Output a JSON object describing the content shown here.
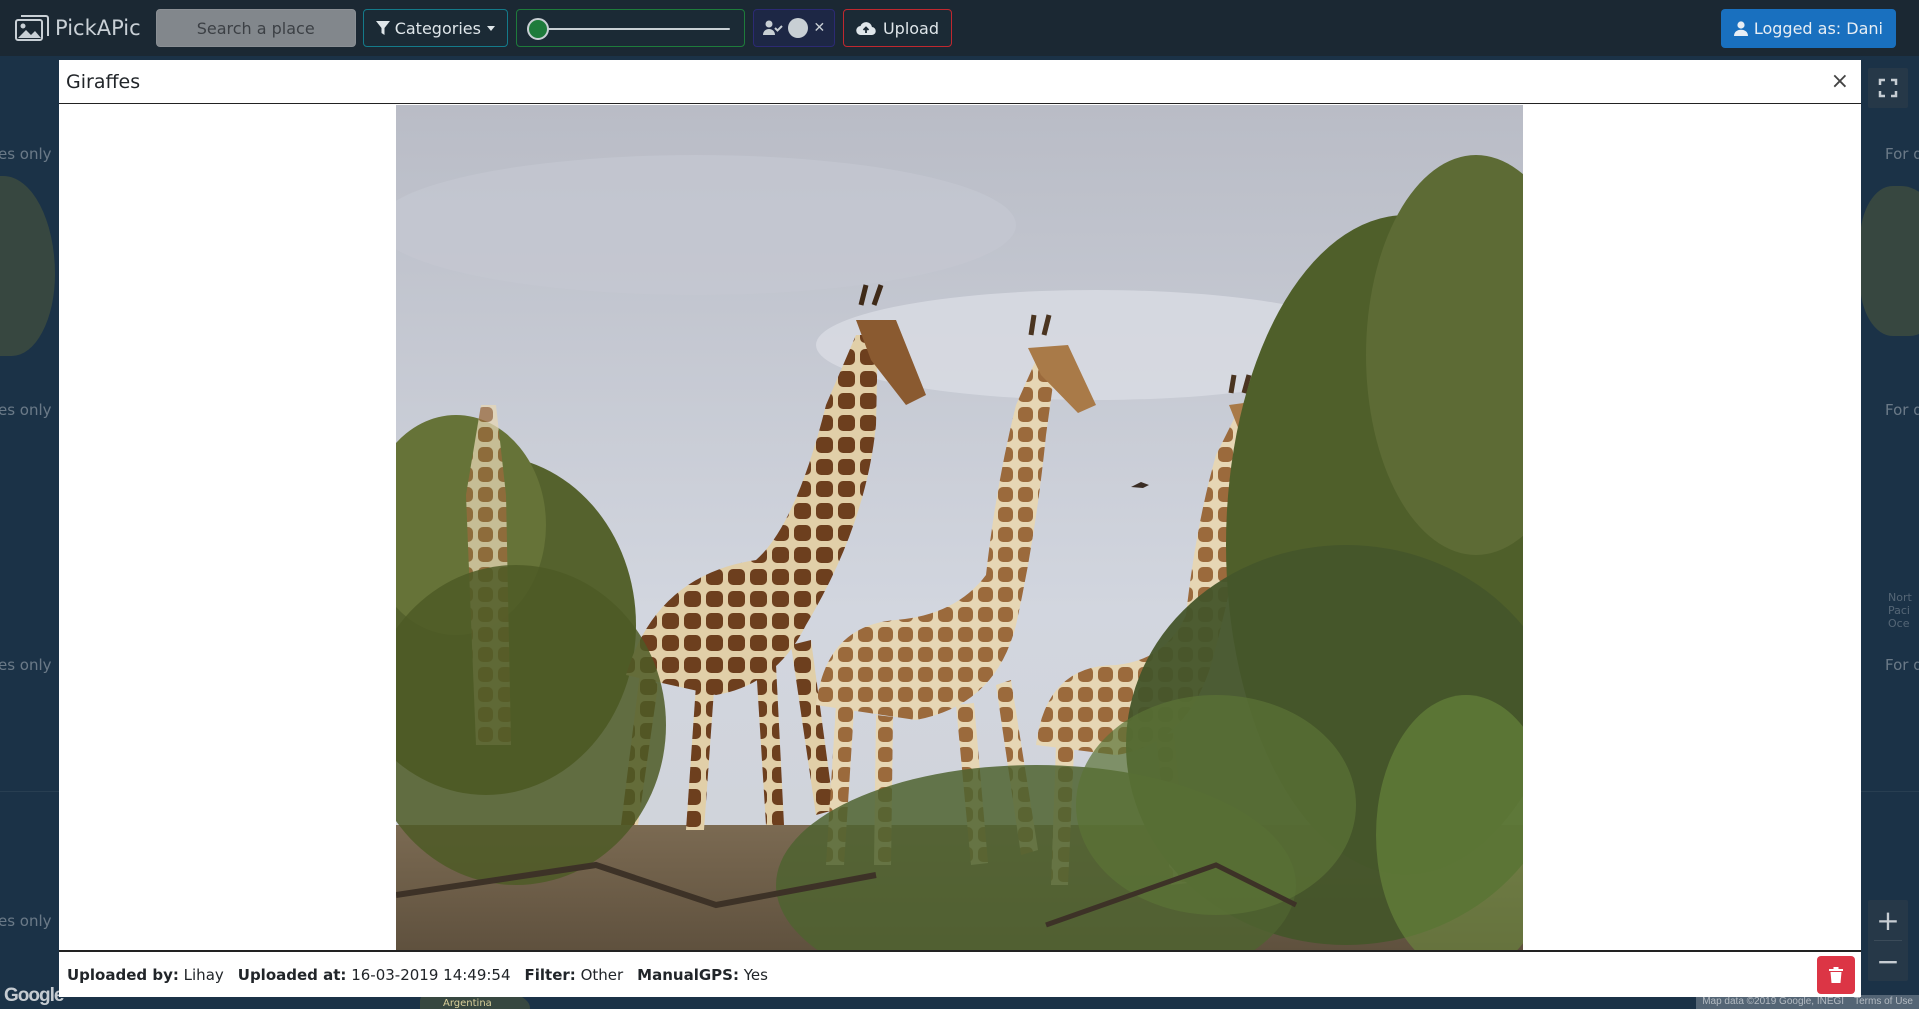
{
  "navbar": {
    "brand": "PickAPic",
    "search_placeholder": "Search a place",
    "categories_label": "Categories",
    "radius_slider_value": 0,
    "upload_label": "Upload",
    "user_label": "Logged as: Dani"
  },
  "map": {
    "dev_watermark": "es only",
    "dev_watermark_right": "For d",
    "ocean_label": "Nort\nPaci\nOce",
    "land_label": "Argentina",
    "google_logo": "Google",
    "attribution": "Map data ©2019 Google, INEGI",
    "terms": "Terms of Use",
    "zoom_in": "+",
    "zoom_out": "−"
  },
  "modal": {
    "title": "Giraffes",
    "close_symbol": "×",
    "image_subject": "three giraffes walking among trees",
    "meta": {
      "uploaded_by_label": "Uploaded by:",
      "uploaded_by": "Lihay",
      "uploaded_at_label": "Uploaded at:",
      "uploaded_at": "16-03-2019 14:49:54",
      "filter_label": "Filter:",
      "filter": "Other",
      "manual_gps_label": "ManualGPS:",
      "manual_gps": "Yes"
    }
  },
  "icons": {
    "brand": "images-icon",
    "filter": "filter-icon",
    "user_check": "user-check-icon",
    "upload": "cloud-upload-icon",
    "user": "user-icon",
    "trash": "trash-icon",
    "fullscreen": "fullscreen-icon"
  },
  "colors": {
    "navbar_bg": "#1b2833",
    "categories_border": "#147a8a",
    "slider_accent": "#1e7b3b",
    "toggle_border": "#2c2a73",
    "upload_border": "#c0282f",
    "user_button": "#1970bf",
    "delete_button": "#dc3545"
  }
}
